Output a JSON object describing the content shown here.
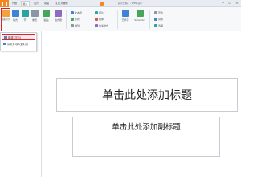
{
  "app": {
    "title": "演示文稿1 - WPS 演示"
  },
  "menu_tabs": [
    {
      "label": "开始"
    },
    {
      "label": "插入"
    },
    {
      "label": "设计"
    },
    {
      "label": "动画"
    },
    {
      "label": "幻灯片放映"
    }
  ],
  "ribbon": {
    "new_slide": "新建幻灯片",
    "layout": "版式",
    "section": "节",
    "reset": "重置",
    "paste": "粘贴",
    "format_painter": "格式刷",
    "text_box": "文本框",
    "shapes": "形状",
    "arrange": "排列",
    "picture": "图片",
    "find": "查找",
    "replace": "替换",
    "select": "选择",
    "art_text": "艺术字",
    "smartart": "SmartArt",
    "media": "媒体",
    "quick_style": "快速样式"
  },
  "context_menu": {
    "items": [
      {
        "label": "新建幻灯片"
      },
      {
        "label": "从文件导入幻灯片"
      }
    ]
  },
  "slide": {
    "title_placeholder": "单击此处添加标题",
    "subtitle_placeholder": "单击此处添加副标题"
  },
  "colors": {
    "accent": "#f5871f",
    "highlight": "#e0202a"
  }
}
